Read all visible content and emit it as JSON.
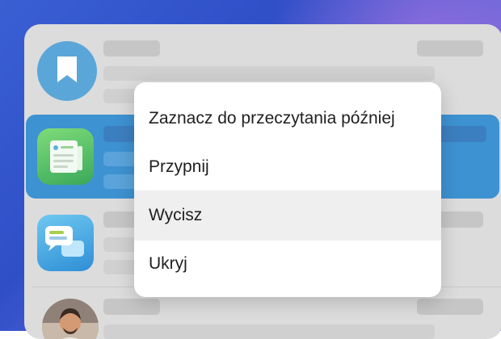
{
  "context_menu": {
    "items": [
      {
        "label": "Zaznacz do przeczytania później",
        "highlighted": false
      },
      {
        "label": "Przypnij",
        "highlighted": false
      },
      {
        "label": "Wycisz",
        "highlighted": true
      },
      {
        "label": "Ukryj",
        "highlighted": false
      }
    ]
  },
  "chat_list": {
    "rows": [
      {
        "icon": "bookmark-icon",
        "selected": false
      },
      {
        "icon": "newspaper-app-icon",
        "selected": true
      },
      {
        "icon": "chat-bubbles-app-icon",
        "selected": false
      },
      {
        "icon": "person-photo",
        "selected": false
      }
    ]
  },
  "colors": {
    "selection": "#3d92d1",
    "menu_background": "#ffffff",
    "menu_highlight": "#efefef",
    "bookmark_circle": "#5ba6d8"
  }
}
